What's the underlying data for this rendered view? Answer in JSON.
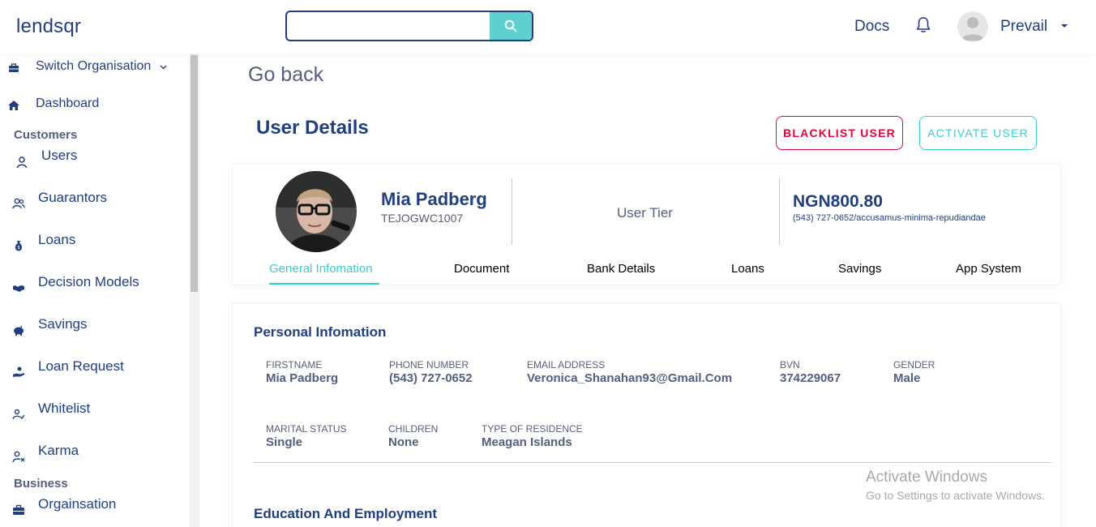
{
  "header": {
    "logo": "lendsqr",
    "search_placeholder": "",
    "docs": "Docs",
    "username": "Prevail"
  },
  "sidebar": {
    "switch_org": "Switch Organisation",
    "dashboard": "Dashboard",
    "customers_title": "Customers",
    "customers": [
      {
        "label": "Users",
        "icon": "user-icon"
      },
      {
        "label": "Guarantors",
        "icon": "users-icon"
      },
      {
        "label": "Loans",
        "icon": "sack-icon"
      },
      {
        "label": "Decision Models",
        "icon": "handshake-icon"
      },
      {
        "label": "Savings",
        "icon": "piggy-bank-icon"
      },
      {
        "label": "Loan Request",
        "icon": "hand-coin-icon"
      },
      {
        "label": "Whitelist",
        "icon": "user-check-icon"
      },
      {
        "label": "Karma",
        "icon": "user-x-icon"
      }
    ],
    "business_title": "Business",
    "business": [
      {
        "label": "Orgainsation",
        "icon": "briefcase-icon"
      }
    ]
  },
  "main": {
    "go_back": "Go back",
    "title": "User Details",
    "blacklist_btn": "BLACKLIST USER",
    "activate_btn": "ACTIVATE USER"
  },
  "summary": {
    "name": "Mia Padberg",
    "code": "TEJOGWC1007",
    "tier_label": "User Tier",
    "balance": "NGN800.80",
    "account": "(543) 727-0652/accusamus-minima-repudiandae",
    "tabs": [
      "General Infomation",
      "Document",
      "Bank Details",
      "Loans",
      "Savings",
      "App System"
    ],
    "active_tab": "General Infomation"
  },
  "personal": {
    "title": "Personal Infomation",
    "fields": [
      {
        "label": "FIRSTNAME",
        "value": "Mia Padberg"
      },
      {
        "label": "PHONE NUMBER",
        "value": "(543) 727-0652"
      },
      {
        "label": "EMAIL ADDRESS",
        "value": "Veronica_Shanahan93@Gmail.Com"
      },
      {
        "label": "BVN",
        "value": "374229067"
      },
      {
        "label": "GENDER",
        "value": "Male"
      },
      {
        "label": "MARITAL STATUS",
        "value": "Single"
      },
      {
        "label": "CHILDREN",
        "value": "None"
      },
      {
        "label": "TYPE OF RESIDENCE",
        "value": "Meagan Islands"
      }
    ]
  },
  "education": {
    "title": "Education And Employment"
  },
  "watermark": {
    "line1": "Activate Windows",
    "line2": "Go to Settings to activate Windows."
  },
  "colors": {
    "primary": "#213f7d",
    "accent": "#39cdcc",
    "danger": "#e4033b",
    "muted": "#545f7d"
  }
}
